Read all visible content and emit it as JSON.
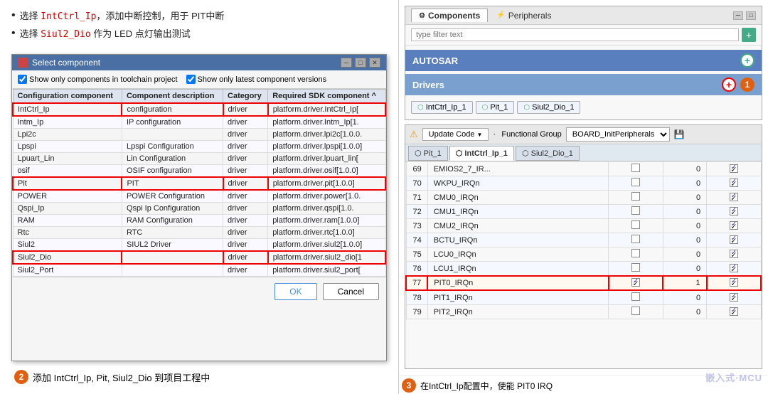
{
  "bullets": [
    {
      "text_before": "选择 ",
      "code": "IntCtrl_Ip",
      "text_after": "，添加中断控制，用于 PIT中断"
    },
    {
      "text_before": "选择 ",
      "code": "Siul2_Dio",
      "text_after": " 作为 LED 点灯输出测试"
    }
  ],
  "dialog": {
    "title": "Select component",
    "checkbox1": "Show only components in toolchain project",
    "checkbox2": "Show only latest component versions",
    "columns": [
      "Configuration component",
      "Component description",
      "Category",
      "Required SDK component"
    ],
    "rows": [
      {
        "name": "IntCtrl_Ip",
        "desc": "configuration",
        "cat": "driver",
        "sdk": "platform.driver.IntCtrl_Ip[",
        "highlight": true
      },
      {
        "name": "Intm_Ip",
        "desc": "IP configuration",
        "cat": "driver",
        "sdk": "platform.driver.Intm_Ip[1.",
        "highlight": false
      },
      {
        "name": "Lpi2c",
        "desc": "",
        "cat": "driver",
        "sdk": "platform.driver.lpi2c[1.0.0.",
        "highlight": false
      },
      {
        "name": "Lpspi",
        "desc": "Lpspi Configuration",
        "cat": "driver",
        "sdk": "platform.driver.lpspi[1.0.0]",
        "highlight": false
      },
      {
        "name": "Lpuart_Lin",
        "desc": "Lin Configuration",
        "cat": "driver",
        "sdk": "platform.driver.lpuart_lin[",
        "highlight": false
      },
      {
        "name": "osif",
        "desc": "OSIF configuration",
        "cat": "driver",
        "sdk": "platform.driver.osif[1.0.0]",
        "highlight": false
      },
      {
        "name": "Pit",
        "desc": "PIT",
        "cat": "driver",
        "sdk": "platform.driver.pit[1.0.0]",
        "highlight": true
      },
      {
        "name": "POWER",
        "desc": "POWER Configuration",
        "cat": "driver",
        "sdk": "platform.driver.power[1.0.",
        "highlight": false
      },
      {
        "name": "Qspi_Ip",
        "desc": "Qspi Ip Configuration",
        "cat": "driver",
        "sdk": "platform.driver.qspi[1.0.",
        "highlight": false
      },
      {
        "name": "RAM",
        "desc": "RAM Configuration",
        "cat": "driver",
        "sdk": "platform.driver.ram[1.0.0]",
        "highlight": false
      },
      {
        "name": "Rtc",
        "desc": "RTC",
        "cat": "driver",
        "sdk": "platform.driver.rtc[1.0.0]",
        "highlight": false
      },
      {
        "name": "Siul2",
        "desc": "SIUL2 Driver",
        "cat": "driver",
        "sdk": "platform.driver.siul2[1.0.0]",
        "highlight": false
      },
      {
        "name": "Siul2_Dio",
        "desc": "",
        "cat": "driver",
        "sdk": "platform.driver.siul2_dio[1",
        "highlight": true
      },
      {
        "name": "Siul2_Port",
        "desc": "",
        "cat": "driver",
        "sdk": "platform.driver.siul2_port[",
        "highlight": false
      }
    ],
    "ok_label": "OK",
    "cancel_label": "Cancel"
  },
  "bottom_label_2": {
    "badge": "2",
    "text": "添加 IntCtrl_Ip, Pit, Siul2_Dio 到项目工程中"
  },
  "components_panel": {
    "tab1": "Components",
    "tab2": "Peripherals",
    "filter_placeholder": "type filter text",
    "autosar_label": "AUTOSAR",
    "drivers_label": "Drivers",
    "chips": [
      "IntCtrl_Ip_1",
      "Pit_1",
      "Siul2_Dio_1"
    ]
  },
  "irq_panel": {
    "update_code_label": "Update Code",
    "functional_group_label": "Functional Group",
    "functional_group_value": "BOARD_InitPeripherals",
    "tabs": [
      "Pit_1",
      "IntCtrl_Ip_1",
      "Siul2_Dio_1"
    ],
    "active_tab": 1,
    "rows": [
      {
        "num": 69,
        "name": "EMIOS2_7_IR...",
        "checked": false,
        "value": 0,
        "enabled": true
      },
      {
        "num": 70,
        "name": "WKPU_IRQn",
        "checked": false,
        "value": 0,
        "enabled": true
      },
      {
        "num": 71,
        "name": "CMU0_IRQn",
        "checked": false,
        "value": 0,
        "enabled": true
      },
      {
        "num": 72,
        "name": "CMU1_IRQn",
        "checked": false,
        "value": 0,
        "enabled": true
      },
      {
        "num": 73,
        "name": "CMU2_IRQn",
        "checked": false,
        "value": 0,
        "enabled": true
      },
      {
        "num": 74,
        "name": "BCTU_IRQn",
        "checked": false,
        "value": 0,
        "enabled": true
      },
      {
        "num": 75,
        "name": "LCU0_IRQn",
        "checked": false,
        "value": 0,
        "enabled": true
      },
      {
        "num": 76,
        "name": "LCU1_IRQn",
        "checked": false,
        "value": 0,
        "enabled": true
      },
      {
        "num": 77,
        "name": "PIT0_IRQn",
        "checked": true,
        "value": 1,
        "enabled": true,
        "highlight": true
      },
      {
        "num": 78,
        "name": "PIT1_IRQn",
        "checked": false,
        "value": 0,
        "enabled": true
      },
      {
        "num": 79,
        "name": "PIT2_IRQn",
        "checked": false,
        "value": 0,
        "enabled": true
      }
    ]
  },
  "bottom_label_3": {
    "badge": "3",
    "text": "在IntCtrl_Ip配置中，使能 PIT0 IRQ"
  },
  "watermark": "嵌入式·MCU"
}
